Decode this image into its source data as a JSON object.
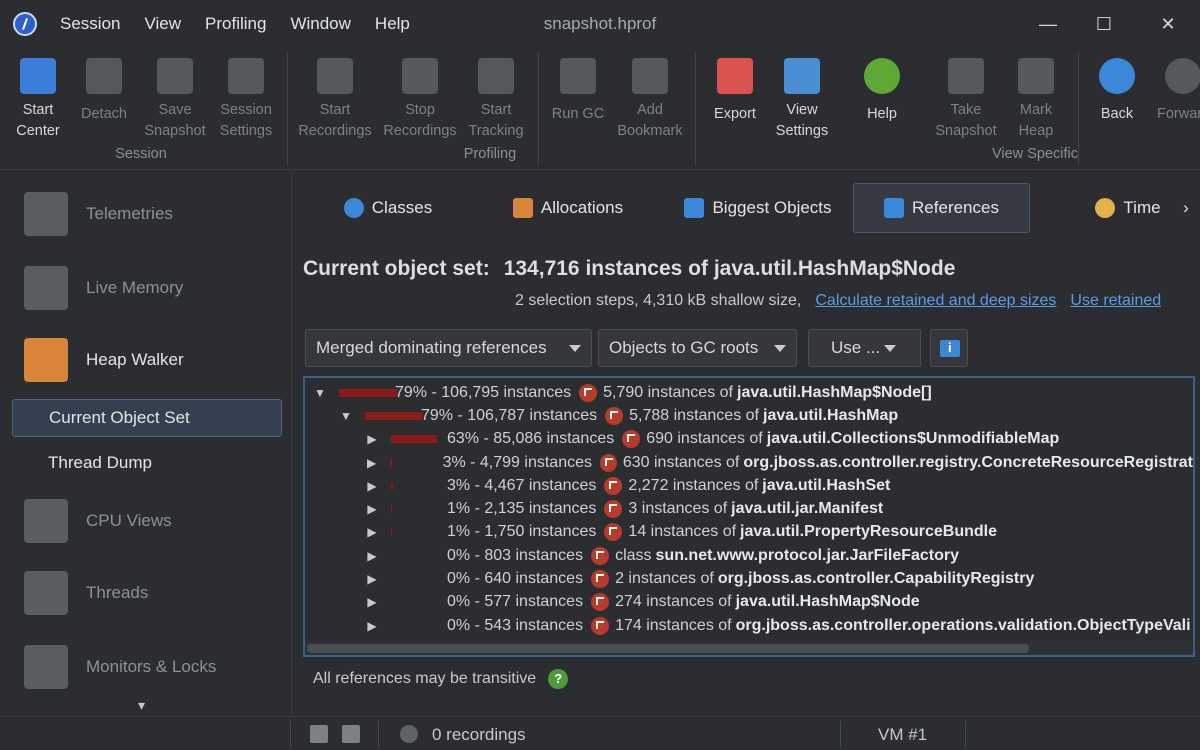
{
  "window": {
    "title": "snapshot.hprof",
    "minimize": "—",
    "maximize": "☐",
    "close": "✕"
  },
  "menu": [
    "Session",
    "View",
    "Profiling",
    "Window",
    "Help"
  ],
  "toolbar": {
    "start_center": [
      "Start",
      "Center"
    ],
    "detach": "Detach",
    "save_snapshot": [
      "Save",
      "Snapshot"
    ],
    "session_settings": [
      "Session",
      "Settings"
    ],
    "group_session": "Session",
    "start_recordings": [
      "Start",
      "Recordings"
    ],
    "stop_recordings": [
      "Stop",
      "Recordings"
    ],
    "start_tracking": [
      "Start",
      "Tracking"
    ],
    "run_gc": "Run GC",
    "add_bookmark": [
      "Add",
      "Bookmark"
    ],
    "group_profiling": "Profiling",
    "export": "Export",
    "view_settings": [
      "View",
      "Settings"
    ],
    "help": "Help",
    "take_snapshot": [
      "Take",
      "Snapshot"
    ],
    "mark_heap": [
      "Mark",
      "Heap"
    ],
    "group_view_specific": "View Specific",
    "back": "Back",
    "forward": "Forwar"
  },
  "sidebar": {
    "telemetries": "Telemetries",
    "live_memory": "Live Memory",
    "heap_walker": "Heap Walker",
    "current_object_set": "Current Object Set",
    "thread_dump": "Thread Dump",
    "cpu_views": "CPU Views",
    "threads": "Threads",
    "monitors_locks": "Monitors & Locks",
    "more": "▾"
  },
  "tabs": {
    "classes": "Classes",
    "allocations": "Allocations",
    "biggest_objects": "Biggest Objects",
    "references": "References",
    "time": "Time",
    "more": "›"
  },
  "object_set": {
    "label": "Current object set:",
    "value": "134,716 instances of java.util.HashMap$Node",
    "details": "2 selection steps, 4,310 kB shallow size,",
    "link_retained": "Calculate retained and deep sizes",
    "link_use_retained": "Use retained"
  },
  "controls": {
    "mode": "Merged dominating references",
    "direction": "Objects to GC roots",
    "use": "Use ..."
  },
  "tree": [
    {
      "depth": 0,
      "arrow": "▼",
      "bar": 58,
      "pct": "79% - 106,795 instances",
      "prefix": "5,790 instances of",
      "cname": "java.util.HashMap$Node[]"
    },
    {
      "depth": 1,
      "arrow": "▼",
      "bar": 58,
      "pct": "79% - 106,787 instances",
      "prefix": "5,788 instances of",
      "cname": "java.util.HashMap"
    },
    {
      "depth": 2,
      "arrow": "▶",
      "bar": 46,
      "pct": "63% - 85,086 instances",
      "prefix": "690 instances of",
      "cname": "java.util.Collections$UnmodifiableMap"
    },
    {
      "depth": 2,
      "arrow": "▶",
      "bar": 2,
      "pct": "3% - 4,799 instances",
      "prefix": "630 instances of",
      "cname": "org.jboss.as.controller.registry.ConcreteResourceRegistrat"
    },
    {
      "depth": 2,
      "arrow": "▶",
      "bar": 2,
      "pct": "3% - 4,467 instances",
      "prefix": "2,272 instances of",
      "cname": "java.util.HashSet"
    },
    {
      "depth": 2,
      "arrow": "▶",
      "bar": 1,
      "pct": "1% - 2,135 instances",
      "prefix": "3 instances of",
      "cname": "java.util.jar.Manifest"
    },
    {
      "depth": 2,
      "arrow": "▶",
      "bar": 1,
      "pct": "1% - 1,750 instances",
      "prefix": "14 instances of",
      "cname": "java.util.PropertyResourceBundle"
    },
    {
      "depth": 2,
      "arrow": "▶",
      "bar": 0,
      "pct": "0% - 803 instances",
      "prefix": "class",
      "cname": "sun.net.www.protocol.jar.JarFileFactory"
    },
    {
      "depth": 2,
      "arrow": "▶",
      "bar": 0,
      "pct": "0% - 640 instances",
      "prefix": "2 instances of",
      "cname": "org.jboss.as.controller.CapabilityRegistry"
    },
    {
      "depth": 2,
      "arrow": "▶",
      "bar": 0,
      "pct": "0% - 577 instances",
      "prefix": "274 instances of",
      "cname": "java.util.HashMap$Node"
    },
    {
      "depth": 2,
      "arrow": "▶",
      "bar": 0,
      "pct": "0% - 543 instances",
      "prefix": "174 instances of",
      "cname": "org.jboss.as.controller.operations.validation.ObjectTypeVali"
    }
  ],
  "footer_note": "All references may be transitive",
  "status": {
    "recordings": "0 recordings",
    "vm": "VM #1"
  },
  "colors": {
    "accent": "#3d5f8a",
    "link": "#5b9ce8",
    "bar": "#8b1a1a"
  }
}
